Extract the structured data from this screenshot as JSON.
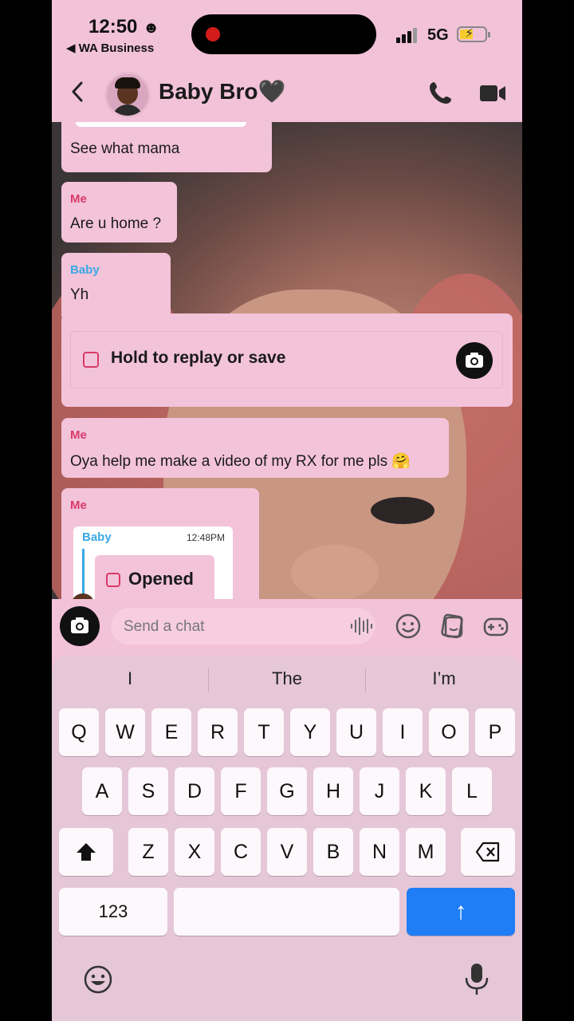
{
  "status": {
    "time": "12:50",
    "time_emoji": "☻",
    "back_app": "◀ WA Business",
    "network": "5G"
  },
  "header": {
    "back_icon": "chevron-left-icon",
    "name": "Baby Bro🖤"
  },
  "messages": [
    {
      "id": "m0",
      "sender": "",
      "text": "See what mama"
    },
    {
      "id": "m1",
      "sender": "Me",
      "text": "Are u home ?"
    },
    {
      "id": "m2",
      "sender": "Baby",
      "text": "Yh"
    },
    {
      "id": "m3",
      "type": "snap",
      "text": "Hold to replay or save"
    },
    {
      "id": "m4",
      "sender": "Me",
      "text": "Oya help me make a video of my RX for me pls 🤗"
    },
    {
      "id": "m5",
      "sender": "Me",
      "quote": {
        "sender": "Baby",
        "time": "12:48PM",
        "text": "Opened"
      }
    }
  ],
  "chatbar": {
    "placeholder": "Send a chat"
  },
  "keyboard": {
    "suggestions": [
      "I",
      "The",
      "I’m"
    ],
    "row1": [
      "Q",
      "W",
      "E",
      "R",
      "T",
      "Y",
      "U",
      "I",
      "O",
      "P"
    ],
    "row2": [
      "A",
      "S",
      "D",
      "F",
      "G",
      "H",
      "J",
      "K",
      "L"
    ],
    "row3": [
      "Z",
      "X",
      "C",
      "V",
      "B",
      "N",
      "M"
    ],
    "numbers": "123",
    "send_glyph": "↑"
  },
  "colors": {
    "bg": "#f2c2d8",
    "me": "#d93a6a",
    "baby": "#3aa9e4",
    "accent": "#1f7df5"
  }
}
